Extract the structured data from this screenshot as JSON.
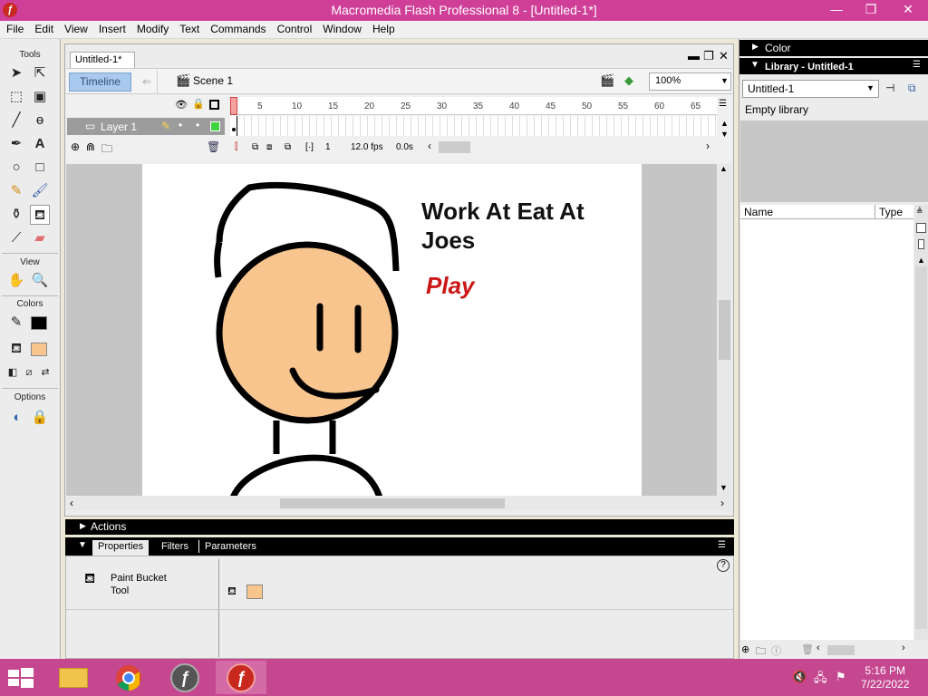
{
  "window": {
    "title": "Macromedia Flash Professional 8 - [Untitled-1*]",
    "minimize": "—",
    "restore": "❐",
    "close": "✕"
  },
  "menu": [
    "File",
    "Edit",
    "View",
    "Insert",
    "Modify",
    "Text",
    "Commands",
    "Control",
    "Window",
    "Help"
  ],
  "tools": {
    "heading_tools": "Tools",
    "heading_view": "View",
    "heading_colors": "Colors",
    "heading_options": "Options",
    "selected_tool": "paint-bucket",
    "stroke_color": "#000000",
    "fill_color": "#f8c58e"
  },
  "document": {
    "tab_label": "Untitled-1*",
    "timeline_label": "Timeline",
    "scene_label": "Scene 1",
    "zoom": "100%"
  },
  "timeline": {
    "layer_name": "Layer 1",
    "frame_numbers": [
      "1",
      "5",
      "10",
      "15",
      "20",
      "25",
      "30",
      "35",
      "40",
      "45",
      "50",
      "55",
      "60",
      "65"
    ],
    "current_frame": "1",
    "fps": "12.0 fps",
    "time": "0.0s"
  },
  "stage": {
    "title_line1": "Work At Eat At",
    "title_line2": "Joes",
    "play_text": "Play",
    "colors": {
      "face": "#f8c58e",
      "outline": "#000000",
      "play": "#cc1717"
    }
  },
  "panels": {
    "actions_label": "Actions",
    "properties_tab": "Properties",
    "filters_tab": "Filters",
    "parameters_tab": "Parameters",
    "tool_name_line1": "Paint Bucket",
    "tool_name_line2": "Tool",
    "color_panel": "Color",
    "library_panel": "Library - Untitled-1",
    "library_select": "Untitled-1",
    "library_empty": "Empty library",
    "col_name": "Name",
    "col_type": "Type"
  },
  "taskbar": {
    "time": "5:16 PM",
    "date": "7/22/2022"
  }
}
